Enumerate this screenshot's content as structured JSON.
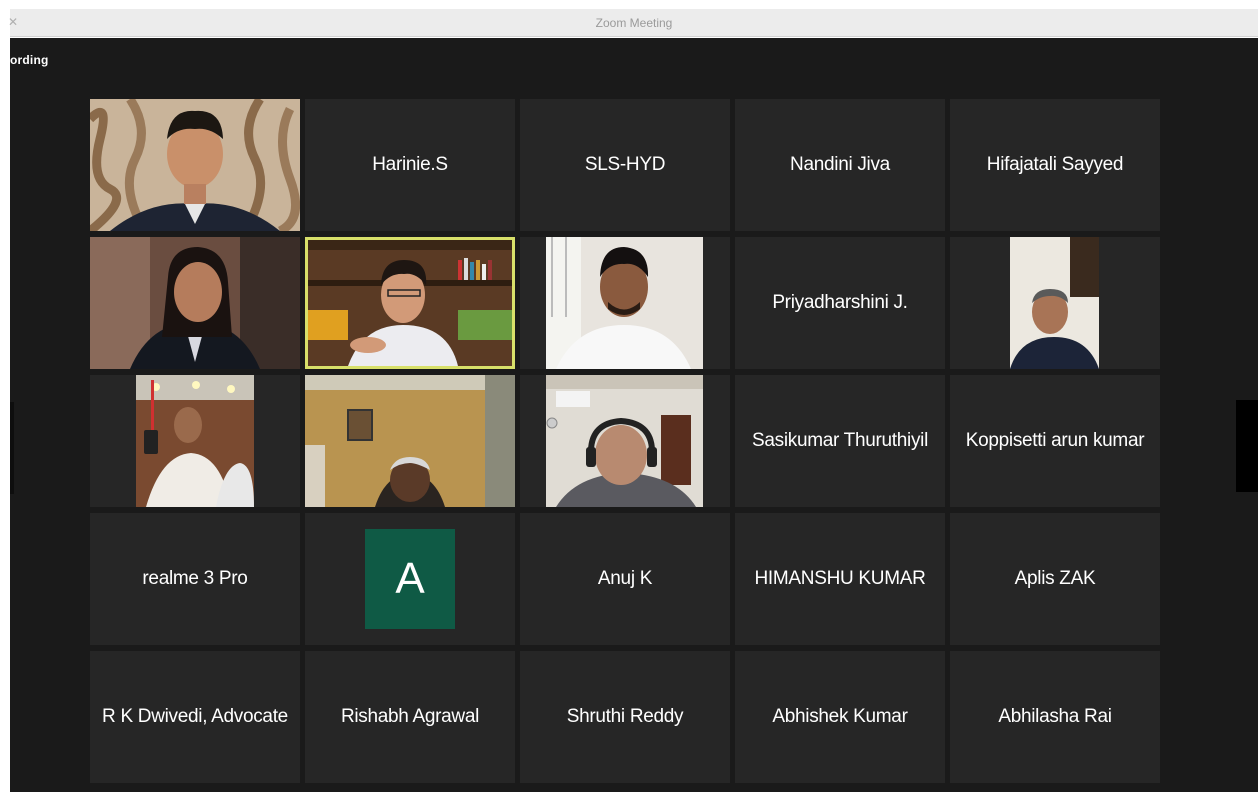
{
  "window": {
    "title": "Zoom Meeting",
    "recording_label": "ording"
  },
  "tiles": [
    {
      "name": "",
      "video": "man-curtains"
    },
    {
      "name": "Harinie.S"
    },
    {
      "name": "SLS-HYD"
    },
    {
      "name": "Nandini Jiva"
    },
    {
      "name": "Hifajatali Sayyed"
    },
    {
      "name": "",
      "video": "woman-blazer"
    },
    {
      "name": "",
      "video": "man-bookshelf",
      "active_speaker": true
    },
    {
      "name": "",
      "video": "man-white-shirt"
    },
    {
      "name": "Priyadharshini J."
    },
    {
      "name": "",
      "video": "man-phone-portrait"
    },
    {
      "name": "",
      "video": "man-restaurant"
    },
    {
      "name": "",
      "video": "man-yellow-wall"
    },
    {
      "name": "",
      "video": "man-headphones"
    },
    {
      "name": "Sasikumar Thuruthiyil"
    },
    {
      "name": "Koppisetti arun kumar"
    },
    {
      "name": "realme 3 Pro"
    },
    {
      "name": "",
      "avatar_letter": "A"
    },
    {
      "name": "Anuj K"
    },
    {
      "name": "HIMANSHU KUMAR"
    },
    {
      "name": "Aplis ZAK"
    },
    {
      "name": "R K Dwivedi, Advocate"
    },
    {
      "name": "Rishabh Agrawal"
    },
    {
      "name": "Shruthi Reddy"
    },
    {
      "name": "Abhishek Kumar"
    },
    {
      "name": "Abhilasha Rai"
    }
  ],
  "colors": {
    "tile_bg": "#262626",
    "stage_bg": "#1a1a1a",
    "speaker_border": "#d8e06a",
    "avatar_bg": "#0f5a45"
  }
}
